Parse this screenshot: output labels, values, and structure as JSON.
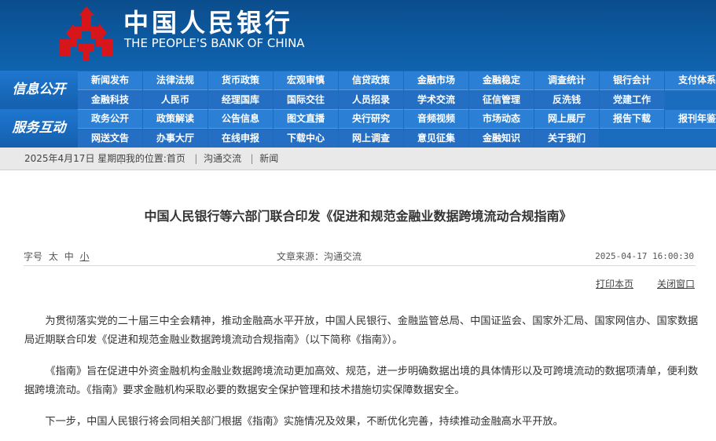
{
  "header": {
    "cn_name": "中国人民银行",
    "en_name": "THE PEOPLE'S BANK OF CHINA",
    "logo_icon": "pboc-logo-icon",
    "logo_color": "#d7161b"
  },
  "nav": {
    "sections": [
      {
        "label": "信息公开",
        "rows": [
          [
            "新闻发布",
            "法律法规",
            "货币政策",
            "宏观审慎",
            "信贷政策",
            "金融市场",
            "金融稳定",
            "调查统计",
            "银行会计",
            "支付体系"
          ],
          [
            "金融科技",
            "人民币",
            "经理国库",
            "国际交往",
            "人员招录",
            "学术交流",
            "征信管理",
            "反洗钱",
            "党建工作"
          ]
        ]
      },
      {
        "label": "服务互动",
        "rows": [
          [
            "政务公开",
            "政策解读",
            "公告信息",
            "图文直播",
            "央行研究",
            "音频视频",
            "市场动态",
            "网上展厅",
            "报告下载",
            "报刊年鉴"
          ],
          [
            "网送文告",
            "办事大厅",
            "在线申报",
            "下载中心",
            "网上调查",
            "意见征集",
            "金融知识",
            "关于我们"
          ]
        ]
      }
    ]
  },
  "breadcrumb": {
    "date": "2025年4月17日 星期四",
    "prefix": "我的位置:",
    "items": [
      "首页",
      "沟通交流",
      "新闻"
    ]
  },
  "article": {
    "title": "中国人民银行等六部门联合印发《促进和规范金融业数据跨境流动合规指南》",
    "font_label": "字号",
    "font_sizes": [
      "太",
      "中",
      "小"
    ],
    "source": "文章来源：沟通交流",
    "time": "2025-04-17 16:00:30",
    "print_label": "打印本页",
    "close_label": "关闭窗口",
    "paragraphs": [
      "为贯彻落实党的二十届三中全会精神，推动金融高水平开放，中国人民银行、金融监管总局、中国证监会、国家外汇局、国家网信办、国家数据局近期联合印发《促进和规范金融业数据跨境流动合规指南》（以下简称《指南》）。",
      "《指南》旨在促进中外资金融机构金融业数据跨境流动更加高效、规范，进一步明确数据出境的具体情形以及可跨境流动的数据项清单，便利数据跨境流动。《指南》要求金融机构采取必要的数据安全保护管理和技术措施切实保障数据安全。",
      "下一步，中国人民银行将会同相关部门根据《指南》实施情况及效果，不断优化完善，持续推动金融高水平开放。"
    ]
  }
}
